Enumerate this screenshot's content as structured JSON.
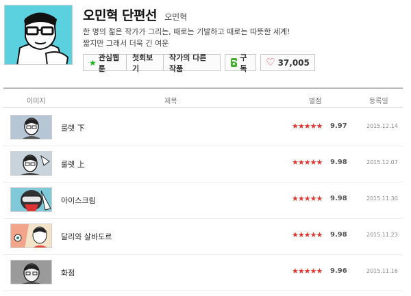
{
  "webtoon": {
    "title": "오민혁 단편선",
    "author": "오민혁",
    "description_line1": "한 명의 젊은 작가가 그리는, 때로는 기발하고 때로는 따뜻한 세계!",
    "description_line2": "짧지만 그래서 더욱 긴 여운"
  },
  "buttons": {
    "favorite": "관심웹툰",
    "first_episode": "첫회보기",
    "other_works": "작가의 다른 작품",
    "subscribe": "구독",
    "likes": "37,005"
  },
  "table": {
    "headers": {
      "image": "이미지",
      "title": "제목",
      "rating": "별점",
      "date": "등록일"
    },
    "rows": [
      {
        "title": "룰렛 下",
        "stars": "★★★★★",
        "score": "9.97",
        "date": "2015.12.14"
      },
      {
        "title": "룰렛 上",
        "stars": "★★★★★",
        "score": "9.98",
        "date": "2015.12.07"
      },
      {
        "title": "아이스크림",
        "stars": "★★★★★",
        "score": "9.98",
        "date": "2015.11.30"
      },
      {
        "title": "달리와 살바도르",
        "stars": "★★★★★",
        "score": "9.98",
        "date": "2015.11.23"
      },
      {
        "title": "화점",
        "stars": "★★★★★",
        "score": "9.96",
        "date": "2015.11.16"
      }
    ]
  },
  "icons": {
    "favorite": "star-icon",
    "subscribe": "rss-icon",
    "likes": "heart-icon"
  },
  "colors": {
    "cover_bg": "#5bd0de",
    "favorite_star": "#1ab51a",
    "rating_star": "#e5352b",
    "heart": "#e8273c",
    "rss": "#42b02a"
  }
}
